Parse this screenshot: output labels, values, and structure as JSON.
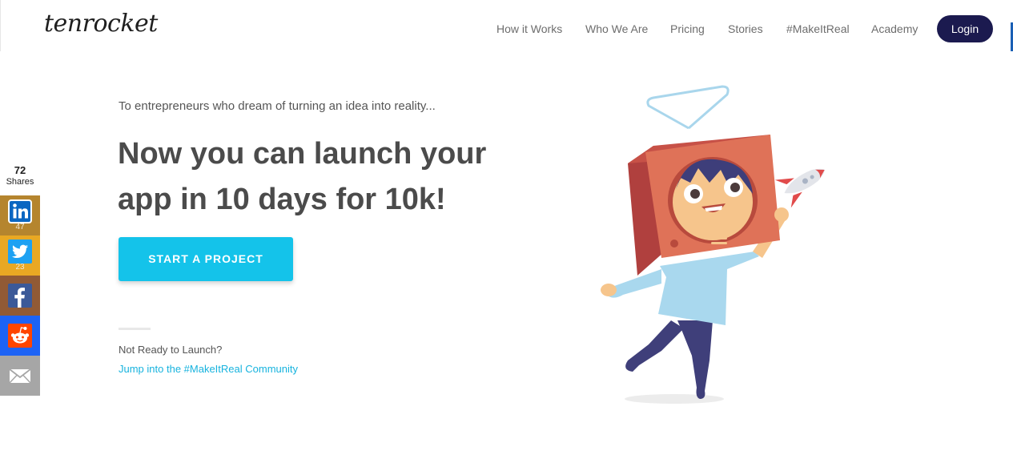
{
  "header": {
    "logo": "tenrocket",
    "nav": [
      {
        "label": "How it Works"
      },
      {
        "label": "Who We Are"
      },
      {
        "label": "Pricing"
      },
      {
        "label": "Stories"
      },
      {
        "label": "#MakeItReal"
      },
      {
        "label": "Academy"
      }
    ],
    "login_label": "Login"
  },
  "share": {
    "total": "72",
    "total_label": "Shares",
    "buttons": [
      {
        "network": "linkedin",
        "icon": "linkedin-icon",
        "count": "47",
        "color": "#b5852e"
      },
      {
        "network": "twitter",
        "icon": "twitter-icon",
        "count": "23",
        "color": "#e9a823"
      },
      {
        "network": "facebook",
        "icon": "facebook-icon",
        "count": "",
        "color": "#915a35"
      },
      {
        "network": "reddit",
        "icon": "reddit-icon",
        "count": "",
        "color": "#1d63f5"
      },
      {
        "network": "email",
        "icon": "email-icon",
        "count": "",
        "color": "#a6a6a6"
      }
    ]
  },
  "hero": {
    "intro": "To entrepreneurs who dream of turning an idea into reality...",
    "headline": "Now you can launch your app in 10 days for 10k!",
    "cta_label": "START A PROJECT",
    "not_ready": "Not Ready to Launch?",
    "community_link": "Jump into the #MakeItReal Community"
  },
  "colors": {
    "accent": "#14c3ea",
    "navy": "#1b1a4f",
    "link": "#17b3de"
  }
}
